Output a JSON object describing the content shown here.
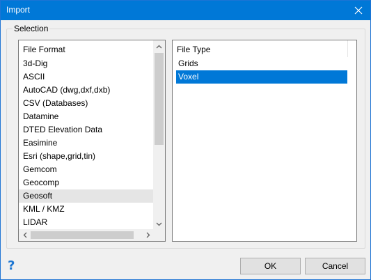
{
  "window": {
    "title": "Import"
  },
  "selection_group": {
    "label": "Selection"
  },
  "file_format_list": {
    "header": "File Format",
    "items": [
      {
        "label": "3d-Dig",
        "state": "normal"
      },
      {
        "label": "ASCII",
        "state": "normal"
      },
      {
        "label": "AutoCAD (dwg,dxf,dxb)",
        "state": "normal"
      },
      {
        "label": "CSV (Databases)",
        "state": "normal"
      },
      {
        "label": "Datamine",
        "state": "normal"
      },
      {
        "label": "DTED Elevation Data",
        "state": "normal"
      },
      {
        "label": "Easimine",
        "state": "normal"
      },
      {
        "label": "Esri (shape,grid,tin)",
        "state": "normal"
      },
      {
        "label": "Gemcom",
        "state": "normal"
      },
      {
        "label": "Geocomp",
        "state": "normal"
      },
      {
        "label": "Geosoft",
        "state": "hover"
      },
      {
        "label": "KML / KMZ",
        "state": "normal"
      },
      {
        "label": "LIDAR",
        "state": "normal"
      }
    ]
  },
  "file_type_list": {
    "header": "File Type",
    "items": [
      {
        "label": "Grids",
        "state": "normal"
      },
      {
        "label": "Voxel",
        "state": "selected"
      }
    ]
  },
  "buttons": {
    "ok": "OK",
    "cancel": "Cancel"
  },
  "icons": {
    "close": "close-icon",
    "help": "help-icon",
    "scroll_up": "chevron-up-icon",
    "scroll_down": "chevron-down-icon",
    "scroll_left": "chevron-left-icon",
    "scroll_right": "chevron-right-icon"
  },
  "colors": {
    "accent": "#0078d7",
    "hover": "#e5e5e5"
  }
}
